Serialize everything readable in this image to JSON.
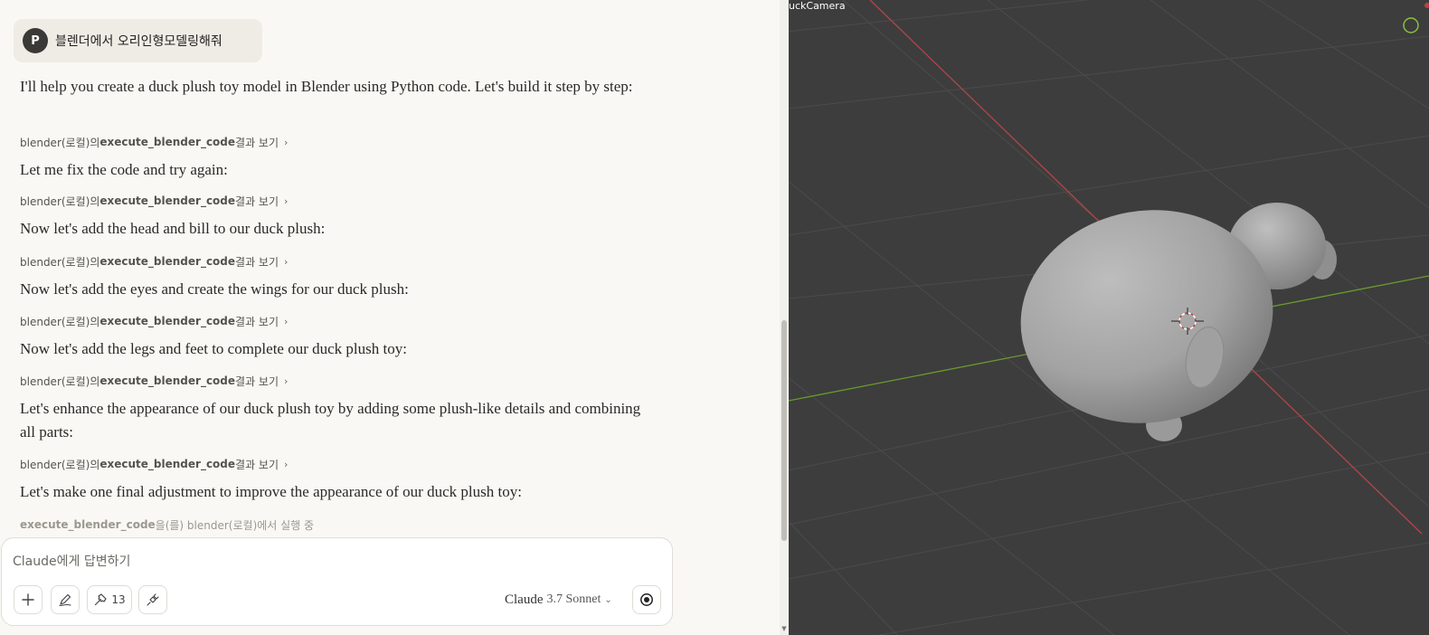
{
  "chat": {
    "user_message": {
      "avatar_initial": "P",
      "text": "블렌더에서 오리인형모델링해줘"
    },
    "assistant": {
      "msg1": "I'll help you create a duck plush toy model in Blender using Python code. Let's build it step by step:",
      "msg2": "Let me fix the code and try again:",
      "msg3": "Now let's add the head and bill to our duck plush:",
      "msg4": "Now let's add the eyes and create the wings for our duck plush:",
      "msg5": "Now let's add the legs and feet to complete our duck plush toy:",
      "msg6": "Let's enhance the appearance of our duck plush toy by adding some plush-like details and combining all parts:",
      "msg7": "Let's make one final adjustment to improve the appearance of our duck plush toy:"
    },
    "tool_call": {
      "prefix": "blender(로컬)의 ",
      "name": "execute_blender_code",
      "suffix": " 결과 보기",
      "chevron": "›"
    },
    "tool_running": {
      "name": "execute_blender_code",
      "suffix": "을(를) blender(로컬)에서 실행 중"
    }
  },
  "composer": {
    "placeholder": "Claude에게 답변하기",
    "value": "",
    "tools_count": "13",
    "model": {
      "name": "Claude",
      "version": "3.7 Sonnet",
      "chevron": "⌄"
    },
    "icons": {
      "add": "plus-icon",
      "style": "pen-icon",
      "tools": "hammer-icon",
      "integrations": "plug-icon",
      "voice": "record-icon"
    }
  },
  "viewport": {
    "camera_label": "uckCamera",
    "colors": {
      "background": "#3d3d3d",
      "grid": "#4a4a4a",
      "x_axis": "#b4444a",
      "y_axis": "#6a9a2e",
      "model": "#a9a9a9"
    }
  }
}
